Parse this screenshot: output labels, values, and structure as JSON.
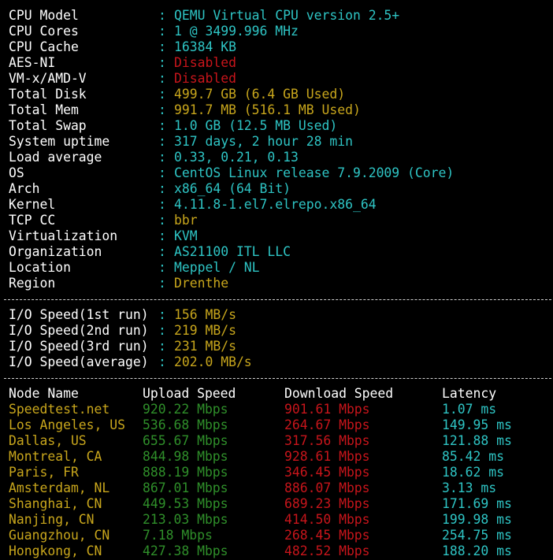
{
  "sysinfo": [
    {
      "label": "CPU Model",
      "value": "QEMU Virtual CPU version 2.5+",
      "color": "cyan"
    },
    {
      "label": "CPU Cores",
      "value": "1 @ 3499.996 MHz",
      "color": "cyan"
    },
    {
      "label": "CPU Cache",
      "value": "16384 KB",
      "color": "cyan"
    },
    {
      "label": "AES-NI",
      "value": "Disabled",
      "color": "red"
    },
    {
      "label": "VM-x/AMD-V",
      "value": "Disabled",
      "color": "red"
    },
    {
      "label": "Total Disk",
      "value": "499.7 GB (6.4 GB Used)",
      "color": "yellow"
    },
    {
      "label": "Total Mem",
      "value": "991.7 MB (516.1 MB Used)",
      "color": "yellow"
    },
    {
      "label": "Total Swap",
      "value": "1.0 GB (12.5 MB Used)",
      "color": "cyan"
    },
    {
      "label": "System uptime",
      "value": "317 days, 2 hour 28 min",
      "color": "cyan"
    },
    {
      "label": "Load average",
      "value": "0.33, 0.21, 0.13",
      "color": "cyan"
    },
    {
      "label": "OS",
      "value": "CentOS Linux release 7.9.2009 (Core)",
      "color": "cyan"
    },
    {
      "label": "Arch",
      "value": "x86_64 (64 Bit)",
      "color": "cyan"
    },
    {
      "label": "Kernel",
      "value": "4.11.8-1.el7.elrepo.x86_64",
      "color": "cyan"
    },
    {
      "label": "TCP CC",
      "value": "bbr",
      "color": "yellow"
    },
    {
      "label": "Virtualization",
      "value": "KVM",
      "color": "cyan"
    },
    {
      "label": "Organization",
      "value": "AS21100 ITL LLC",
      "color": "cyan"
    },
    {
      "label": "Location",
      "value": "Meppel / NL",
      "color": "cyan"
    },
    {
      "label": "Region",
      "value": "Drenthe",
      "color": "yellow"
    }
  ],
  "separator_char": ":",
  "io": [
    {
      "label": "I/O Speed(1st run)",
      "value": "156 MB/s"
    },
    {
      "label": "I/O Speed(2nd run)",
      "value": "219 MB/s"
    },
    {
      "label": "I/O Speed(3rd run)",
      "value": "231 MB/s"
    },
    {
      "label": "I/O Speed(average)",
      "value": "202.0 MB/s"
    }
  ],
  "speed_header": {
    "node": "Node Name",
    "upload": "Upload Speed",
    "download": "Download Speed",
    "latency": "Latency"
  },
  "speed_rows": [
    {
      "node": "Speedtest.net",
      "upload": "920.22 Mbps",
      "download": "901.61 Mbps",
      "latency": "1.07 ms"
    },
    {
      "node": "Los Angeles, US",
      "upload": "536.68 Mbps",
      "download": "264.67 Mbps",
      "latency": "149.95 ms"
    },
    {
      "node": "Dallas, US",
      "upload": "655.67 Mbps",
      "download": "317.56 Mbps",
      "latency": "121.88 ms"
    },
    {
      "node": "Montreal, CA",
      "upload": "844.98 Mbps",
      "download": "928.61 Mbps",
      "latency": "85.42 ms"
    },
    {
      "node": "Paris, FR",
      "upload": "888.19 Mbps",
      "download": "346.45 Mbps",
      "latency": "18.62 ms"
    },
    {
      "node": "Amsterdam, NL",
      "upload": "867.01 Mbps",
      "download": "886.07 Mbps",
      "latency": "3.13 ms"
    },
    {
      "node": "Shanghai, CN",
      "upload": "449.53 Mbps",
      "download": "689.23 Mbps",
      "latency": "171.69 ms"
    },
    {
      "node": "Nanjing, CN",
      "upload": "213.03 Mbps",
      "download": "414.50 Mbps",
      "latency": "199.98 ms"
    },
    {
      "node": "Guangzhou, CN",
      "upload": "7.18 Mbps",
      "download": "268.45 Mbps",
      "latency": "254.75 ms"
    },
    {
      "node": "Hongkong, CN",
      "upload": "427.38 Mbps",
      "download": "482.52 Mbps",
      "latency": "188.20 ms"
    }
  ],
  "colors": {
    "background": "#000000",
    "label": "#ffffff",
    "cyan": "#2ec4c4",
    "red": "#c8151b",
    "yellow": "#c8a61c",
    "green": "#2f8f2a",
    "separator_line": "#d0d0d0"
  }
}
